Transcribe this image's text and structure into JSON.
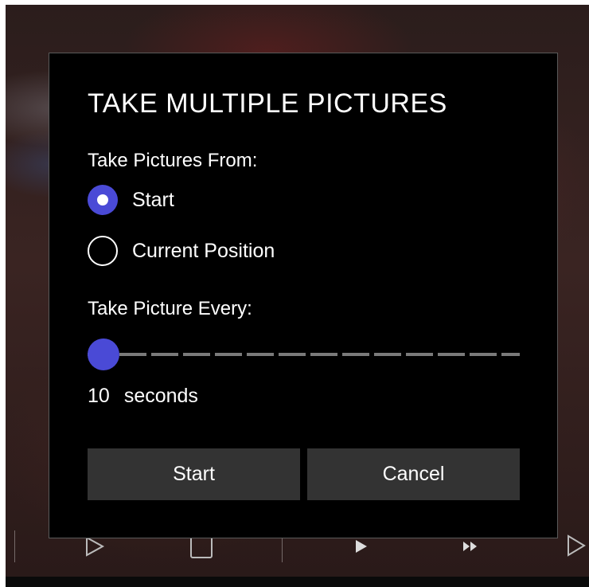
{
  "dialog": {
    "title": "TAKE MULTIPLE PICTURES",
    "from_label": "Take Pictures From:",
    "options": [
      {
        "label": "Start",
        "selected": true
      },
      {
        "label": "Current Position",
        "selected": false
      }
    ],
    "interval_label": "Take Picture Every:",
    "interval": {
      "value": "10",
      "unit": "seconds"
    },
    "start_button": "Start",
    "cancel_button": "Cancel"
  },
  "player_controls": {
    "icons": [
      "play-outline-icon",
      "stop-icon",
      "play-icon",
      "fast-forward-icon",
      "next-outline-icon"
    ]
  },
  "colors": {
    "accent": "#4a4ad6",
    "dialog_bg": "#000000",
    "button_bg": "#333333",
    "dialog_border": "#5a5a5a"
  }
}
